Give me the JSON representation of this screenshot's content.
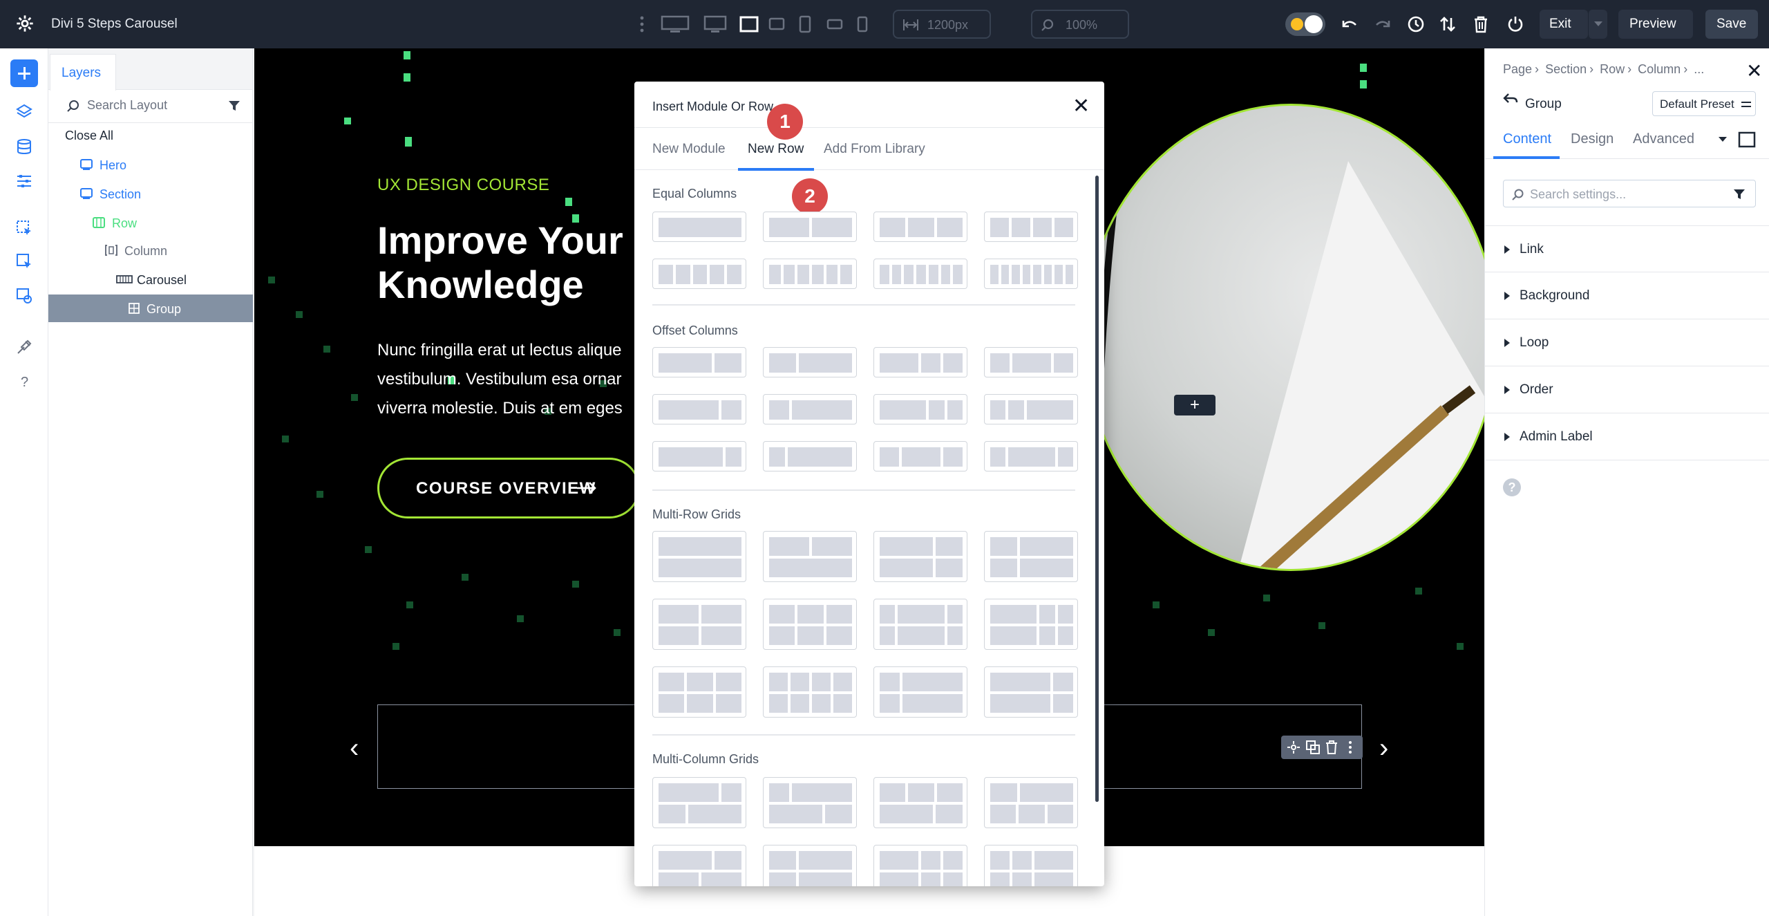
{
  "topbar": {
    "title": "Divi 5 Steps Carousel",
    "width_value": "1200px",
    "zoom_value": "100%",
    "exit_label": "Exit",
    "preview_label": "Preview",
    "save_label": "Save"
  },
  "layers": {
    "tab_label": "Layers",
    "search_placeholder": "Search Layout",
    "close_all_label": "Close All",
    "items": [
      {
        "label": "Hero"
      },
      {
        "label": "Section"
      },
      {
        "label": "Row"
      },
      {
        "label": "Column"
      },
      {
        "label": "Carousel"
      },
      {
        "label": "Group"
      }
    ]
  },
  "canvas": {
    "eyebrow": "UX DESIGN COURSE",
    "headline_line1": "Improve Your U",
    "headline_line2": "Knowledge",
    "para_line1": "Nunc fringilla erat ut lectus alique",
    "para_line2": "vestibulum. Vestibulum esa ornar",
    "para_line3": "viverra molestie. Duis at em eges",
    "cta_label": "COURSE OVERVIEW",
    "add_chip": "+",
    "prev_arrow": "‹",
    "next_arrow": "›"
  },
  "modal": {
    "title": "Insert Module Or Row",
    "tabs": [
      {
        "label": "New Module"
      },
      {
        "label": "New Row"
      },
      {
        "label": "Add From Library"
      }
    ],
    "active_tab": "New Row",
    "badges": [
      "1",
      "2"
    ],
    "groups": [
      {
        "title": "Equal Columns"
      },
      {
        "title": "Offset Columns"
      },
      {
        "title": "Multi-Row Grids"
      },
      {
        "title": "Multi-Column Grids"
      }
    ],
    "close_glyph": "✕"
  },
  "settings": {
    "breadcrumb": [
      "Page",
      "Section",
      "Row",
      "Column",
      "..."
    ],
    "title": "Group",
    "preset_label": "Default Preset",
    "tabs": [
      {
        "label": "Content"
      },
      {
        "label": "Design"
      },
      {
        "label": "Advanced"
      }
    ],
    "search_placeholder": "Search settings...",
    "groups": [
      {
        "label": "Link"
      },
      {
        "label": "Background"
      },
      {
        "label": "Loop"
      },
      {
        "label": "Order"
      },
      {
        "label": "Admin Label"
      }
    ],
    "help_glyph": "?",
    "close_glyph": "✕"
  },
  "colors": {
    "accent": "#2b7cf6",
    "lime": "#a3e635",
    "badge_red": "#d94a4a",
    "topbar": "#1f2633"
  }
}
